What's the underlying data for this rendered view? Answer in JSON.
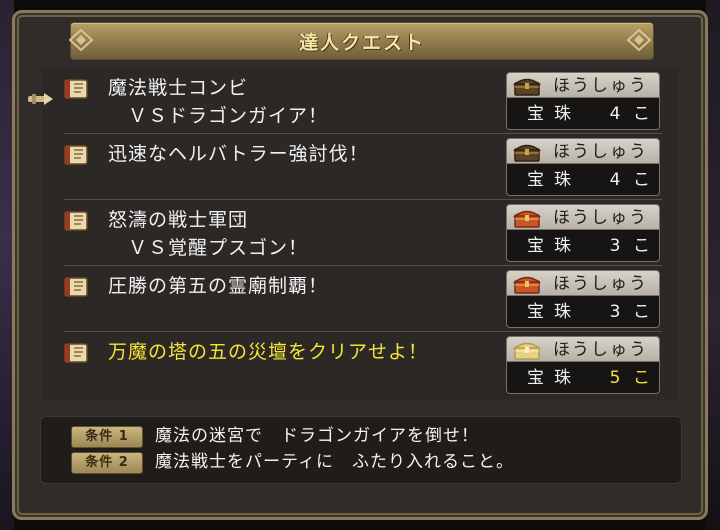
{
  "window": {
    "title": "達人クエスト"
  },
  "quests": [
    {
      "name": "魔法戦士コンビ\n　ＶＳドラゴンガイア！",
      "reward_label": "ほうしゅう",
      "reward_item": "宝珠",
      "reward_count": "4",
      "reward_unit": "こ",
      "chest": "dark-chest-icon",
      "highlighted": false,
      "selected": true
    },
    {
      "name": "迅速なヘルバトラー強討伐！",
      "reward_label": "ほうしゅう",
      "reward_item": "宝珠",
      "reward_count": "4",
      "reward_unit": "こ",
      "chest": "dark-chest-icon",
      "highlighted": false,
      "selected": false
    },
    {
      "name": "怒濤の戦士軍団\n　ＶＳ覚醒プスゴン！",
      "reward_label": "ほうしゅう",
      "reward_item": "宝珠",
      "reward_count": "3",
      "reward_unit": "こ",
      "chest": "red-chest-icon",
      "highlighted": false,
      "selected": false
    },
    {
      "name": "圧勝の第五の霊廟制覇！",
      "reward_label": "ほうしゅう",
      "reward_item": "宝珠",
      "reward_count": "3",
      "reward_unit": "こ",
      "chest": "red-chest-icon",
      "highlighted": false,
      "selected": false
    },
    {
      "name": "万魔の塔の五の災壇をクリアせよ！",
      "reward_label": "ほうしゅう",
      "reward_item": "宝珠",
      "reward_count": "5",
      "reward_unit": "こ",
      "chest": "gold-chest-icon",
      "highlighted": true,
      "selected": false
    }
  ],
  "conditions": [
    {
      "badge": "条件 1",
      "text": "魔法の迷宮で　ドラゴンガイアを倒せ！"
    },
    {
      "badge": "条件 2",
      "text": "魔法戦士をパーティに　ふたり入れること。"
    }
  ],
  "colors": {
    "highlight": "#f4e438",
    "text": "#f1f1f1",
    "title_bar": "#b99f66",
    "frame": "#8a7a5c"
  },
  "icons": {
    "quest": "quest-book-icon",
    "cursor": "hand-pointer-icon",
    "title_left": "ornament-left-icon",
    "title_right": "ornament-right-icon"
  }
}
